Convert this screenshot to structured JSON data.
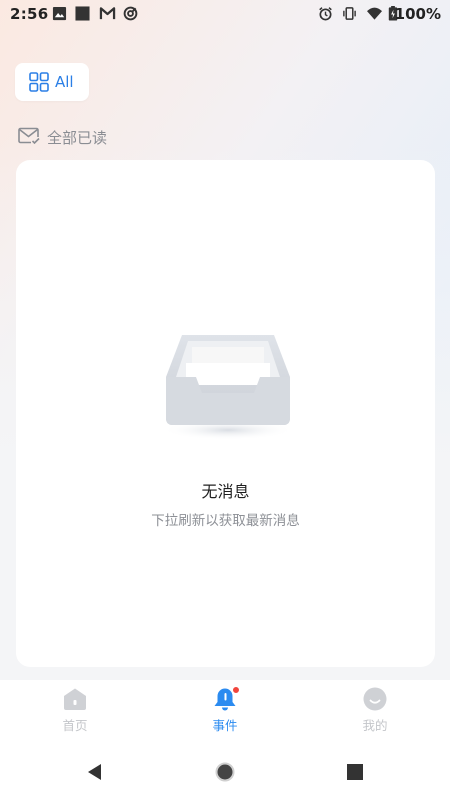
{
  "status_bar": {
    "time": "2:56",
    "battery": "100%",
    "icons": [
      "image-icon",
      "square-icon",
      "gmail-icon",
      "sync-icon",
      "alarm-icon",
      "vibrate-icon",
      "wifi-icon",
      "battery-icon"
    ]
  },
  "filter": {
    "label": "All",
    "icon": "grid-icon",
    "accent": "#2b7fe6"
  },
  "mark_all_read": {
    "label": "全部已读",
    "icon": "mail-check-icon"
  },
  "empty_state": {
    "title": "无消息",
    "subtitle": "下拉刷新以获取最新消息",
    "icon": "empty-inbox-icon"
  },
  "bottom_nav": {
    "items": [
      {
        "label": "首页",
        "icon": "home-icon",
        "active": false
      },
      {
        "label": "事件",
        "icon": "bell-icon",
        "active": true,
        "badge": true
      },
      {
        "label": "我的",
        "icon": "profile-icon",
        "active": false
      }
    ],
    "active_color": "#2b8bf0",
    "inactive_color": "#c4c6ca"
  },
  "system_nav": {
    "buttons": [
      "back-icon",
      "home-circle-icon",
      "recents-icon"
    ]
  }
}
